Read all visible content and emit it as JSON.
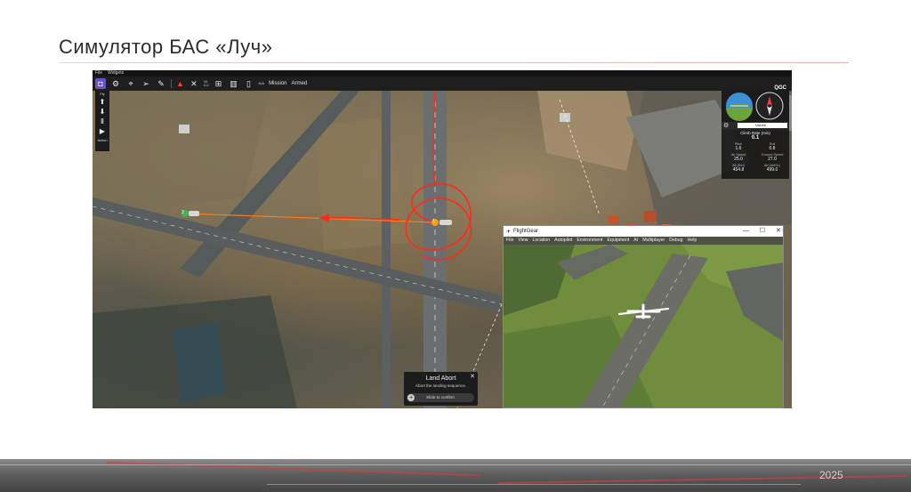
{
  "slide": {
    "title": "Симулятор БАС «Луч»",
    "year": "2025"
  },
  "qgc": {
    "menu": [
      "File",
      "Widgets"
    ],
    "toolbar": {
      "gps_count": "10",
      "gps_hdop": "0.0",
      "battery": "N/A",
      "flight_mode": "Mission",
      "armed_status": "Armed",
      "logo": "QGC"
    },
    "fly_tools": [
      "Fly",
      "Action"
    ],
    "telemetry": {
      "selector": "Values",
      "header": "Climb Rate (m/s)",
      "header_value": "0.1",
      "items": [
        {
          "name": "Pitch",
          "value": "1.6"
        },
        {
          "name": "Roll",
          "value": "0.8"
        },
        {
          "name": "Air Speed",
          "value": "25.0"
        },
        {
          "name": "Ground Speed",
          "value": "27.0"
        },
        {
          "name": "Alt (Rel)",
          "value": "454.8"
        },
        {
          "name": "Alt (AMSL)",
          "value": "499.0"
        }
      ]
    },
    "waypoints": [
      "3",
      "1"
    ],
    "toast": {
      "title": "Land Abort",
      "subtitle": "Abort the landing sequence.",
      "slider": "Slide to confirm"
    }
  },
  "flightgear": {
    "title": "FlightGear",
    "menu": [
      "File",
      "View",
      "Location",
      "Autopilot",
      "Environment",
      "Equipment",
      "AI",
      "Multiplayer",
      "Debug",
      "Help"
    ]
  }
}
